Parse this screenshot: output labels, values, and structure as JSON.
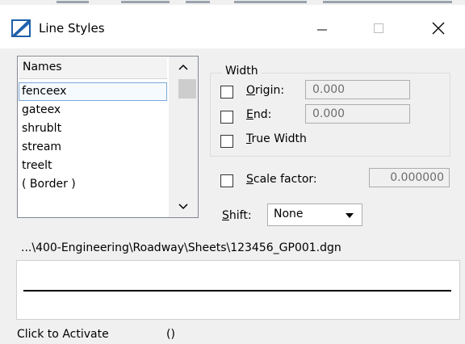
{
  "window": {
    "title": "Line Styles",
    "icon": "line-styles-app-icon",
    "controls": {
      "minimize": "minimize-icon",
      "maximize": "maximize-icon",
      "close": "close-icon"
    }
  },
  "names_list": {
    "header": "Names",
    "items": [
      "fenceex",
      "gateex",
      "shrublt",
      "stream",
      "treelt",
      "( Border )"
    ],
    "selected": "fenceex"
  },
  "width_group": {
    "label": "Width",
    "origin": {
      "label": "Origin:",
      "value": "0.000",
      "checked": false
    },
    "end": {
      "label": "End:",
      "value": "0.000",
      "checked": false
    },
    "true_width": {
      "label": "True Width",
      "checked": false
    }
  },
  "scale_factor": {
    "label": "Scale factor:",
    "value": "0.000000",
    "checked": false
  },
  "shift": {
    "label": "Shift:",
    "value": "None"
  },
  "file_path": "...\\400-Engineering\\Roadway\\Sheets\\123456_GP001.dgn",
  "status": {
    "text": "Click to Activate",
    "extra": "()"
  },
  "colors": {
    "selection_border": "#7aa7d9",
    "dialog_bg": "#f0f0f0"
  }
}
